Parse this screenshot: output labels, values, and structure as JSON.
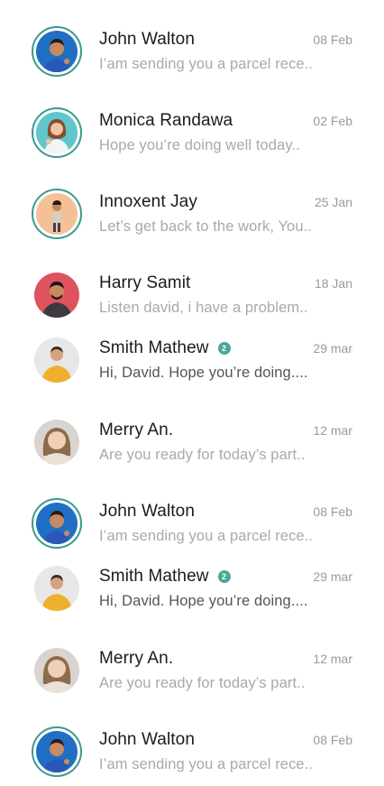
{
  "conversations": [
    {
      "name": "John Walton",
      "date": "08 Feb",
      "preview": "I’am sending you a parcel rece..",
      "badge": "",
      "unread": false,
      "avatar": "john-walton"
    },
    {
      "name": "Monica Randawa",
      "date": "02 Feb",
      "preview": "Hope you’re doing well today..",
      "badge": "",
      "unread": false,
      "avatar": "monica-randawa"
    },
    {
      "name": "Innoxent Jay",
      "date": "25 Jan",
      "preview": "Let’s get back to the work, You..",
      "badge": "",
      "unread": false,
      "avatar": "innoxent-jay"
    },
    {
      "name": "Harry Samit",
      "date": "18 Jan",
      "preview": "Listen david, i have a problem..",
      "badge": "",
      "unread": false,
      "avatar": "harry-samit"
    },
    {
      "name": "Smith Mathew",
      "date": "29 mar",
      "preview": "Hi, David. Hope you’re doing....",
      "badge": "2",
      "unread": true,
      "avatar": "smith-mathew"
    },
    {
      "name": "Merry An.",
      "date": "12 mar",
      "preview": "Are you ready for today’s part..",
      "badge": "",
      "unread": false,
      "avatar": "merry-an"
    },
    {
      "name": "John Walton",
      "date": "08 Feb",
      "preview": "I’am sending you a parcel rece..",
      "badge": "",
      "unread": false,
      "avatar": "john-walton"
    },
    {
      "name": "Smith Mathew",
      "date": "29 mar",
      "preview": "Hi, David. Hope you’re doing....",
      "badge": "2",
      "unread": true,
      "avatar": "smith-mathew"
    },
    {
      "name": "Merry An.",
      "date": "12 mar",
      "preview": "Are you ready for today’s part..",
      "badge": "",
      "unread": false,
      "avatar": "merry-an"
    },
    {
      "name": "John Walton",
      "date": "08 Feb",
      "preview": "I’am sending you a parcel rece..",
      "badge": "",
      "unread": false,
      "avatar": "john-walton"
    }
  ],
  "colors": {
    "accent": "#3a9a8e",
    "badge": "#4aa79a",
    "name": "#1b1b1b",
    "date": "#9a9a9a",
    "preview": "#a9a9a9",
    "preview_unread": "#555555"
  }
}
